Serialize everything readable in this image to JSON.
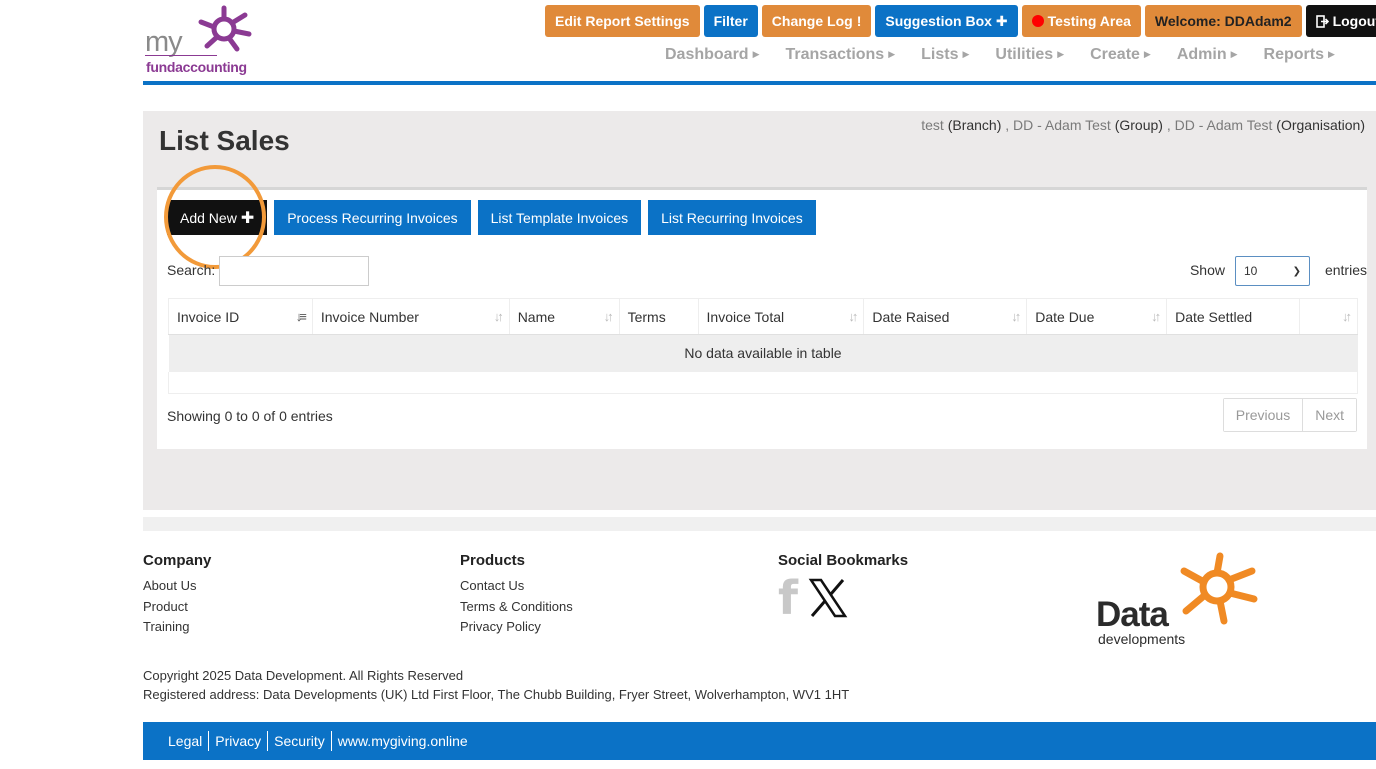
{
  "logo": {
    "my": "my",
    "brand": "fundaccounting",
    "accent": "#8b3a93"
  },
  "topbar": {
    "edit_report": "Edit Report Settings",
    "filter": "Filter",
    "change_log": "Change Log",
    "change_log_icon": "!",
    "suggestion_box": "Suggestion Box",
    "suggestion_icon": "✚",
    "testing_area": "Testing Area",
    "welcome": "Welcome:  DDAdam2",
    "logout": "Logout"
  },
  "nav": {
    "items": [
      "Dashboard",
      "Transactions",
      "Lists",
      "Utilities",
      "Create",
      "Admin",
      "Reports"
    ]
  },
  "page": {
    "title": "List Sales",
    "context": {
      "branch": "test",
      "branch_label": "(Branch)",
      "sep1": " , ",
      "group": "DD - Adam Test",
      "group_label": "(Group)",
      "sep2": " , ",
      "org": "DD - Adam Test",
      "org_label": "(Organisation)"
    }
  },
  "actions": {
    "add_new": "Add New",
    "process_recurring": "Process Recurring Invoices",
    "list_template": "List Template Invoices",
    "list_recurring": "List Recurring Invoices"
  },
  "table": {
    "search_label": "Search:",
    "search_value": "",
    "show_label": "Show",
    "show_value": "10",
    "entries_label": "entries",
    "columns": [
      "Invoice ID",
      "Invoice Number",
      "Name",
      "Terms",
      "Invoice Total",
      "Date Raised",
      "Date Due",
      "Date Settled"
    ],
    "empty_text": "No data available in table",
    "info": "Showing 0 to 0 of 0 entries",
    "previous": "Previous",
    "next": "Next"
  },
  "footer": {
    "company": {
      "heading": "Company",
      "links": [
        "About Us",
        "Product",
        "Training"
      ]
    },
    "products": {
      "heading": "Products",
      "links": [
        "Contact Us",
        "Terms & Conditions",
        "Privacy Policy"
      ]
    },
    "social": {
      "heading": "Social Bookmarks",
      "icons": [
        "facebook-icon",
        "x-icon"
      ]
    },
    "dd_logo": {
      "word": "Data",
      "sub": "developments"
    },
    "copyright": "Copyright 2025 Data Development. All Rights Reserved",
    "address": "Registered address: Data Developments (UK) Ltd First Floor, The Chubb Building, Fryer Street, Wolverhampton, WV1 1HT",
    "bottom_links": [
      "Legal",
      "Privacy",
      "Security",
      "www.mygiving.online"
    ]
  },
  "colors": {
    "blue": "#0b72c6",
    "orange": "#e08a3a",
    "highlight": "#f29a3a"
  }
}
